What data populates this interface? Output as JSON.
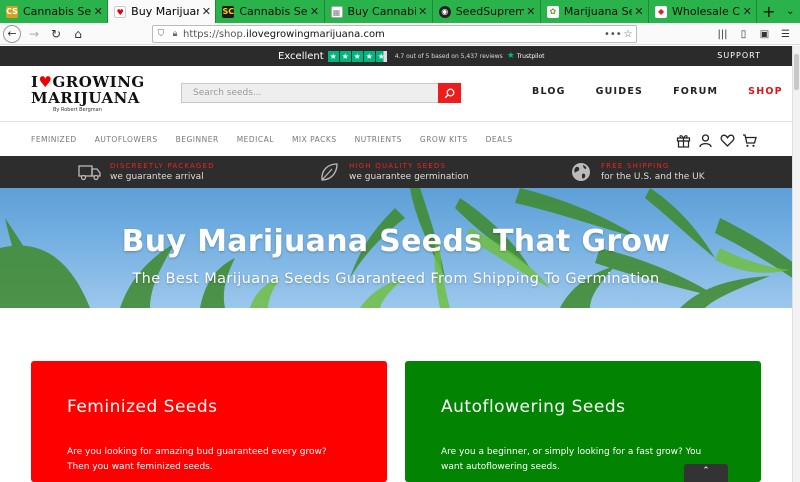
{
  "browser": {
    "tabs": [
      {
        "label": "Cannabis Seeds",
        "favicon_text": "CS",
        "favicon_color": "#d6a01c",
        "active": false
      },
      {
        "label": "Buy Marijuana S",
        "favicon_text": "♥",
        "favicon_color": "#e00000",
        "active": true
      },
      {
        "label": "Cannabis Seeds",
        "favicon_text": "SC",
        "favicon_color": "#1a1a1a",
        "active": false
      },
      {
        "label": "Buy Cannabis S",
        "favicon_text": "▦",
        "favicon_color": "#888888",
        "active": false
      },
      {
        "label": "SeedSupreme S",
        "favicon_text": "◉",
        "favicon_color": "#222222",
        "active": false
      },
      {
        "label": "Marijuana Seed",
        "favicon_text": "✿",
        "favicon_color": "#6a9c2a",
        "active": false
      },
      {
        "label": "Wholesale Cann",
        "favicon_text": "◆",
        "favicon_color": "#d22",
        "active": false
      }
    ],
    "url_prefix": "https://shop.",
    "url_domain": "ilovegrowingmarijuana.com",
    "new_tab": "+",
    "tab_menu": "⌄"
  },
  "trustbar": {
    "excellent": "Excellent",
    "stars": [
      "★",
      "★",
      "★",
      "★",
      "★"
    ],
    "rating_text": "4.7 out of 5 based on 5,437 reviews",
    "logo": "Trustpilot",
    "support": "SUPPORT"
  },
  "header": {
    "logo_line1_pre": "I",
    "logo_heart": "♥",
    "logo_line1_post": "GROWING",
    "logo_line2": "MARIJUANA",
    "logo_byline": "By Robert Bergman",
    "search_placeholder": "Search seeds...",
    "nav": {
      "blog": "BLOG",
      "guides": "GUIDES",
      "forum": "FORUM",
      "shop": "SHOP"
    }
  },
  "categories": [
    "FEMINIZED",
    "AUTOFLOWERS",
    "BEGINNER",
    "MEDICAL",
    "MIX PACKS",
    "NUTRIENTS",
    "GROW KITS",
    "DEALS"
  ],
  "benefits": [
    {
      "title": "DISCREETLY PACKAGED",
      "subtitle": "we guarantee arrival"
    },
    {
      "title": "HIGH QUALITY SEEDS",
      "subtitle": "we guarantee germination"
    },
    {
      "title": "FREE SHIPPING",
      "subtitle": "for the U.S. and the UK"
    }
  ],
  "hero": {
    "title": "Buy Marijuana Seeds That Grow",
    "subtitle": "The Best Marijuana Seeds Guaranteed From Shipping To Germination"
  },
  "cards": {
    "feminized": {
      "title": "Feminized Seeds",
      "line1": "Are you looking for amazing bud guaranteed every grow?",
      "line2": "Then you want feminized seeds."
    },
    "autoflowering": {
      "title": "Autoflowering Seeds",
      "line1": "Are you a beginner, or simply looking for a fast grow? You",
      "line2": "want autoflowering seeds."
    }
  },
  "scroll_top": "⌃",
  "colors": {
    "tab_strip": "#2ab24b",
    "accent_red": "#e0161b",
    "card_red": "#fe0000",
    "card_green": "#028402",
    "trustpilot_green": "#00b67a"
  }
}
